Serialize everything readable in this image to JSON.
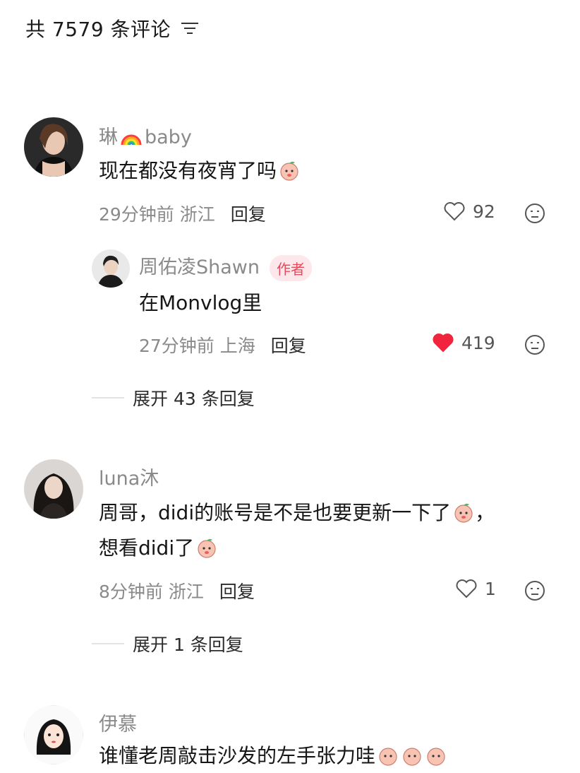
{
  "header": {
    "title": "共 7579 条评论",
    "sort_icon": "sort-lines-icon"
  },
  "comments": [
    {
      "username_prefix": "琳",
      "username_suffix": "baby",
      "username_emoji": "rainbow-icon",
      "text": "现在都没有夜宵了吗",
      "time": "29分钟前",
      "location": "浙江",
      "reply_label": "回复",
      "likes": "92",
      "liked": false,
      "replies": [
        {
          "username": "周佑凌Shawn",
          "badge": "作者",
          "text": "在Monvlog里",
          "time": "27分钟前",
          "location": "上海",
          "reply_label": "回复",
          "likes": "419",
          "liked": true
        }
      ],
      "expand_label": "展开 43 条回复"
    },
    {
      "username": "luna沐",
      "text_line1": "周哥，didi的账号是不是也要更新一下了",
      "text_line1_tail": "，",
      "text_line2": "想看didi了",
      "time": "8分钟前",
      "location": "浙江",
      "reply_label": "回复",
      "likes": "1",
      "liked": false,
      "expand_label": "展开 1 条回复"
    },
    {
      "username": "伊慕",
      "text": "谁懂老周敲击沙发的左手张力哇"
    }
  ],
  "colors": {
    "liked_heart": "#f0243c",
    "badge_bg": "#fde7ea",
    "badge_text": "#e64a5c"
  }
}
